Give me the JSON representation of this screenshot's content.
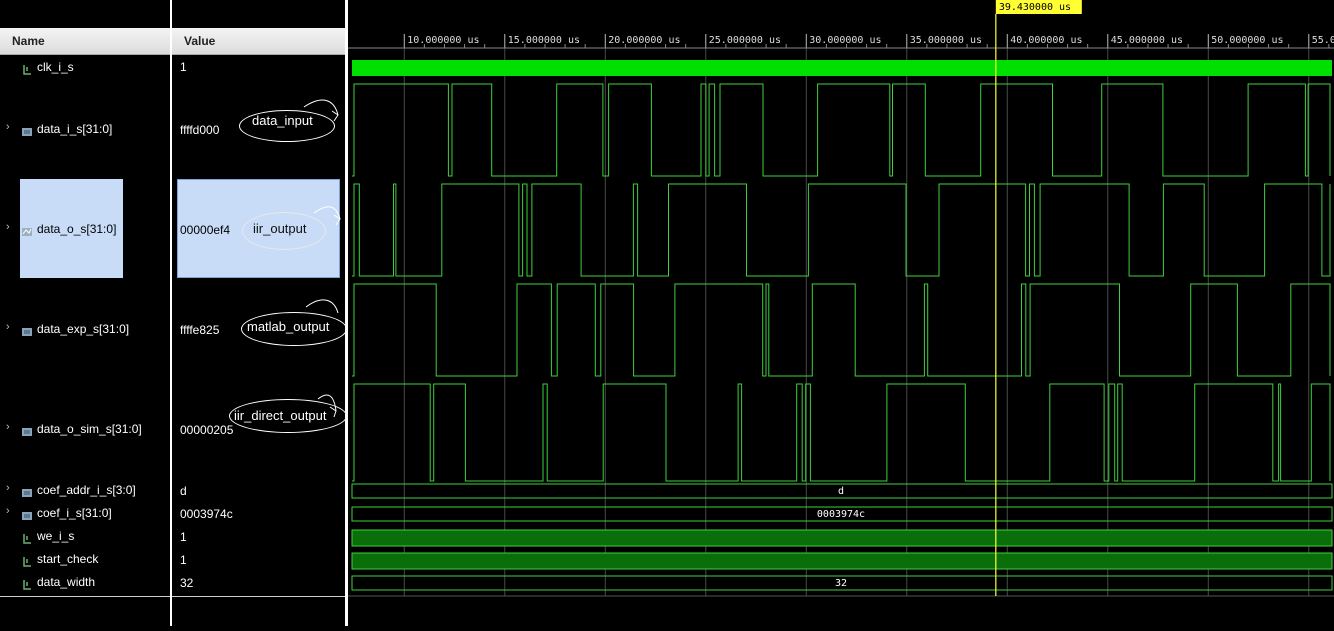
{
  "headers": {
    "name": "Name",
    "value": "Value"
  },
  "signals": [
    {
      "name": "clk_i_s",
      "value": "1",
      "icon": "single-bit-icon"
    },
    {
      "name": "data_i_s[31:0]",
      "value": "ffffd000",
      "icon": "bus-icon"
    },
    {
      "name": "data_o_s[31:0]",
      "value": "00000ef4",
      "icon": "bus-analog-icon"
    },
    {
      "name": "data_exp_s[31:0]",
      "value": "ffffe825",
      "icon": "bus-icon"
    },
    {
      "name": "data_o_sim_s[31:0]",
      "value": "00000205",
      "icon": "bus-icon"
    },
    {
      "name": "coef_addr_i_s[3:0]",
      "value": "d",
      "icon": "bus-icon"
    },
    {
      "name": "coef_i_s[31:0]",
      "value": "0003974c",
      "icon": "bus-icon"
    },
    {
      "name": "we_i_s",
      "value": "1",
      "icon": "single-bit-icon"
    },
    {
      "name": "start_check",
      "value": "1",
      "icon": "single-bit-icon"
    },
    {
      "name": "data_width",
      "value": "32",
      "icon": "single-bit-icon"
    }
  ],
  "annotations": [
    "data_input",
    "iir_output",
    "matlab_output",
    "iir_direct_output"
  ],
  "timeline": {
    "cursor_label": "39.430000 us",
    "cursor_time_us": 39.43,
    "tick_labels": [
      "10.000000 us",
      "15.000000 us",
      "20.000000 us",
      "25.000000 us",
      "30.000000 us",
      "35.000000 us",
      "40.000000 us",
      "45.000000 us",
      "50.000000 us",
      "55.000000 us"
    ],
    "tick_times_us": [
      10,
      15,
      20,
      25,
      30,
      35,
      40,
      45,
      50,
      55
    ]
  },
  "bus_labels": {
    "coef_addr": "d",
    "coef": "0003974c",
    "data_width": "32"
  },
  "colors": {
    "wave": "#3fcf3f",
    "clock": "#00e000",
    "cursor": "#ffff33",
    "grid": "#4a4a4a",
    "selection": "#c8dcf8"
  }
}
